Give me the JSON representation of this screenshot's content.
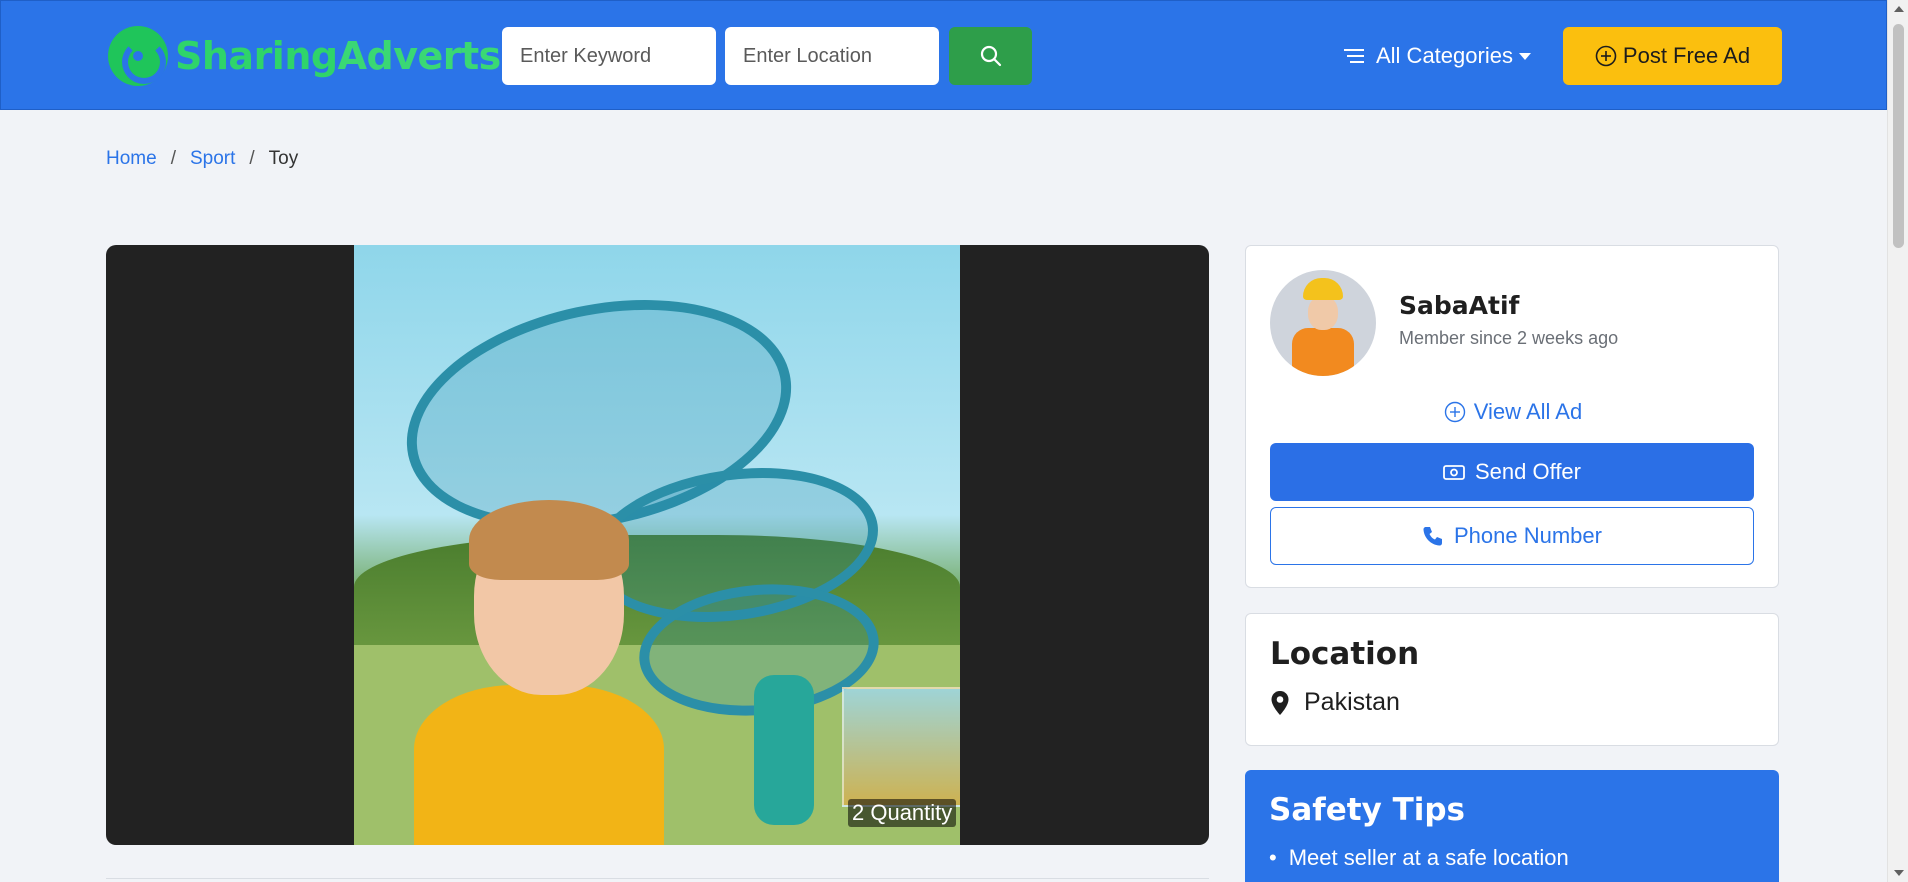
{
  "brand": {
    "part1": "Sharing",
    "part2": "Adverts"
  },
  "search": {
    "keyword_placeholder": "Enter Keyword",
    "location_placeholder": "Enter Location"
  },
  "header": {
    "categories_label": "All Categories",
    "post_label": "Post Free Ad"
  },
  "breadcrumb": {
    "items": [
      "Home",
      "Sport",
      "Toy"
    ]
  },
  "gallery": {
    "overlay_text": "2 Quantity"
  },
  "seller": {
    "name": "SabaAtif",
    "member_since": "Member since 2 weeks ago",
    "view_all_label": "View All Ad",
    "send_offer_label": "Send Offer",
    "phone_label": "Phone Number"
  },
  "location": {
    "title": "Location",
    "value": "Pakistan"
  },
  "safety": {
    "title": "Safety Tips",
    "tips": [
      "Meet seller at a safe location"
    ]
  },
  "colors": {
    "header_bg": "#2b74e8",
    "brand_green": "#2fd46a",
    "search_btn": "#2e9e4a",
    "post_btn": "#fbbf0e",
    "primary": "#2b6fe6"
  }
}
